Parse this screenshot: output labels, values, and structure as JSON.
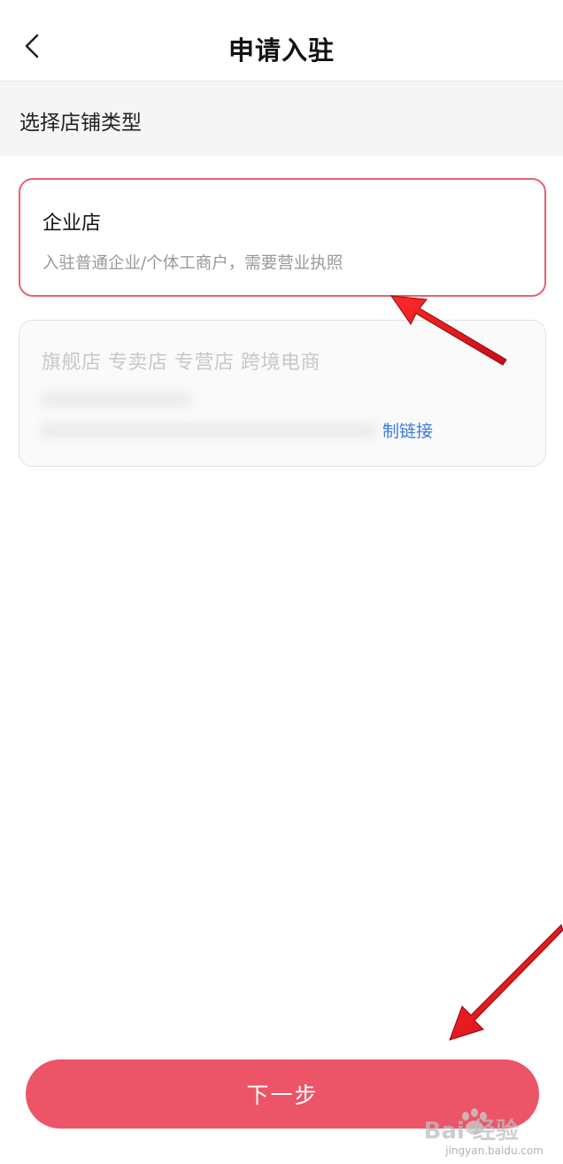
{
  "header": {
    "title": "申请入驻"
  },
  "section": {
    "title": "选择店铺类型"
  },
  "cards": {
    "enterprise": {
      "title": "企业店",
      "description": "入驻普通企业/个体工商户，需要营业执照"
    },
    "flagship": {
      "title": "旗舰店 专卖店 专营店 跨境电商",
      "link": "制链接"
    }
  },
  "footer": {
    "next_label": "下一步"
  },
  "watermark": {
    "logo": "Bai 经验",
    "url": "jingyan.baidu.com"
  },
  "colors": {
    "accent": "#ec5468",
    "selected_border": "#e86076",
    "link": "#3b7ce0",
    "annotation_arrow": "#e8141e"
  }
}
